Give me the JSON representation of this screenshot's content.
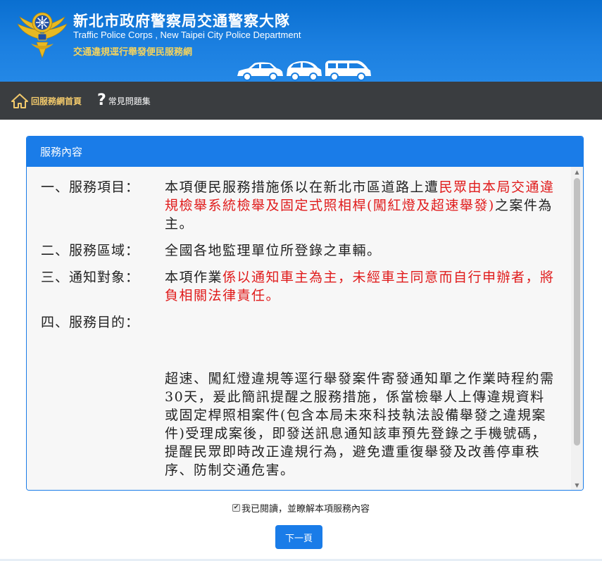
{
  "header": {
    "title_zh": "新北市政府警察局交通警察大隊",
    "title_en": "Traffic Police Corps , New Taipei City Police Department",
    "subtitle": "交通違規逕行舉發便民服務網"
  },
  "nav": {
    "home_label": "回服務網首頁",
    "faq_label": "常見問題集"
  },
  "panel": {
    "title": "服務內容",
    "items": [
      {
        "label": "一、服務項目：",
        "text_a": "本項便民服務措施係以在新北市區道路上遭",
        "text_red": "民眾由本局交通違規檢舉系統檢舉及固定式照相桿(闖紅燈及超速舉發)",
        "text_b": "之案件為主。"
      },
      {
        "label": "二、服務區域：",
        "text_a": "全國各地監理單位所登錄之車輛。",
        "text_red": "",
        "text_b": ""
      },
      {
        "label": "三、通知對象：",
        "text_a": "本項作業",
        "text_red": "係以通知車主為主，未經車主同意而自行申辦者，將負相關法律責任。",
        "text_b": ""
      },
      {
        "label": "四、服務目的：",
        "text_a": "",
        "text_red": "",
        "text_b": ""
      }
    ],
    "purpose_text": "超速、闖紅燈違規等逕行舉發案件寄發通知單之作業時程約需30天，爰此簡訊提醒之服務措施，係當檢舉人上傳違規資料或固定桿照相案件(包含本局未來科技執法設備舉發之違規案件)受理成案後，即發送訊息通知該車預先登錄之手機號碼，提醒民眾即時改正違規行為，避免遭重復舉發及改善停車秩序、防制交通危害。"
  },
  "agree": {
    "label": "我已閱讀，並瞭解本項服務內容",
    "checked": true
  },
  "next_button": "下一頁",
  "colors": {
    "header_blue": "#1b7fe0",
    "navbar": "#3a3d40",
    "panel_blue": "#1a7ce8",
    "red_text": "#e01b1b",
    "subtitle_gold": "#f4d35e"
  }
}
